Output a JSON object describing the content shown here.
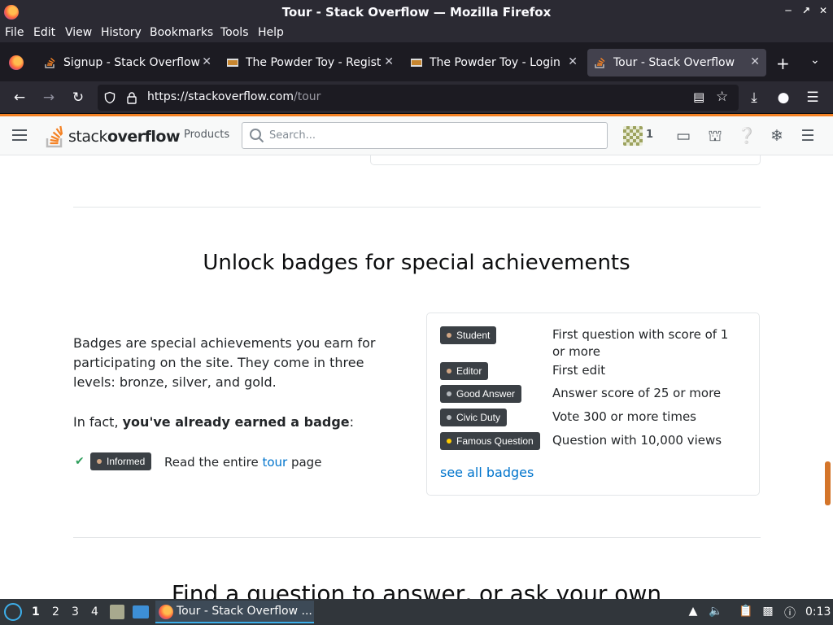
{
  "window": {
    "title": "Tour - Stack Overflow — Mozilla Firefox"
  },
  "menu": [
    "File",
    "Edit",
    "View",
    "History",
    "Bookmarks",
    "Tools",
    "Help"
  ],
  "tabs": [
    {
      "label": "Signup - Stack Overflow",
      "active": false
    },
    {
      "label": "The Powder Toy - Registe",
      "active": false
    },
    {
      "label": "The Powder Toy - Login",
      "active": false
    },
    {
      "label": "Tour - Stack Overflow",
      "active": true
    }
  ],
  "urlbar": {
    "host": "https://stackoverflow.com",
    "path": "/tour"
  },
  "so": {
    "logo_light": "stack",
    "logo_bold": "overflow",
    "products": "Products",
    "search_placeholder": "Search...",
    "reputation": "1"
  },
  "section": {
    "heading": "Unlock badges for special achievements",
    "description": "Badges are special achievements you earn for participating on the site. They come in three levels: bronze, silver, and gold.",
    "infact_prefix": "In fact, ",
    "infact_bold": "you've already earned a badge",
    "infact_suffix": ":",
    "earned_badge": "Informed",
    "earned_text_prefix": "Read the entire ",
    "earned_link": "tour",
    "earned_text_suffix": " page"
  },
  "badges": [
    {
      "name": "Student",
      "desc": "First question with score of 1 or more",
      "tier_color": "#d1a684"
    },
    {
      "name": "Editor",
      "desc": "First edit",
      "tier_color": "#d1a684"
    },
    {
      "name": "Good Answer",
      "desc": "Answer score of 25 or more",
      "tier_color": "#b4b8bc"
    },
    {
      "name": "Civic Duty",
      "desc": "Vote 300 or more times",
      "tier_color": "#b4b8bc"
    },
    {
      "name": "Famous Question",
      "desc": "Question with 10,000 views",
      "tier_color": "#ffcc01"
    }
  ],
  "see_all": "see all badges",
  "next_heading": "Find a question to answer, or ask your own",
  "taskbar": {
    "workspaces": [
      "1",
      "2",
      "3",
      "4"
    ],
    "task_label": "Tour - Stack Overflow ...",
    "clock": "0:13"
  },
  "colors": {
    "accent": "#f48225",
    "link": "#0074cc",
    "badge_bg": "#3b4045"
  }
}
